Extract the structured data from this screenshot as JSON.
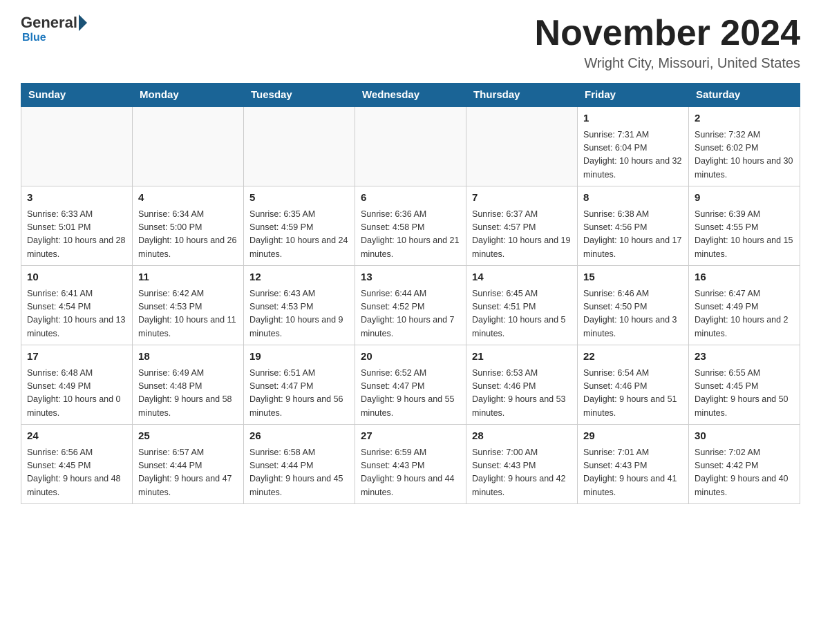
{
  "header": {
    "logo_general": "General",
    "logo_blue": "Blue",
    "month_title": "November 2024",
    "location": "Wright City, Missouri, United States"
  },
  "weekdays": [
    "Sunday",
    "Monday",
    "Tuesday",
    "Wednesday",
    "Thursday",
    "Friday",
    "Saturday"
  ],
  "weeks": [
    [
      {
        "day": "",
        "info": ""
      },
      {
        "day": "",
        "info": ""
      },
      {
        "day": "",
        "info": ""
      },
      {
        "day": "",
        "info": ""
      },
      {
        "day": "",
        "info": ""
      },
      {
        "day": "1",
        "info": "Sunrise: 7:31 AM\nSunset: 6:04 PM\nDaylight: 10 hours and 32 minutes."
      },
      {
        "day": "2",
        "info": "Sunrise: 7:32 AM\nSunset: 6:02 PM\nDaylight: 10 hours and 30 minutes."
      }
    ],
    [
      {
        "day": "3",
        "info": "Sunrise: 6:33 AM\nSunset: 5:01 PM\nDaylight: 10 hours and 28 minutes."
      },
      {
        "day": "4",
        "info": "Sunrise: 6:34 AM\nSunset: 5:00 PM\nDaylight: 10 hours and 26 minutes."
      },
      {
        "day": "5",
        "info": "Sunrise: 6:35 AM\nSunset: 4:59 PM\nDaylight: 10 hours and 24 minutes."
      },
      {
        "day": "6",
        "info": "Sunrise: 6:36 AM\nSunset: 4:58 PM\nDaylight: 10 hours and 21 minutes."
      },
      {
        "day": "7",
        "info": "Sunrise: 6:37 AM\nSunset: 4:57 PM\nDaylight: 10 hours and 19 minutes."
      },
      {
        "day": "8",
        "info": "Sunrise: 6:38 AM\nSunset: 4:56 PM\nDaylight: 10 hours and 17 minutes."
      },
      {
        "day": "9",
        "info": "Sunrise: 6:39 AM\nSunset: 4:55 PM\nDaylight: 10 hours and 15 minutes."
      }
    ],
    [
      {
        "day": "10",
        "info": "Sunrise: 6:41 AM\nSunset: 4:54 PM\nDaylight: 10 hours and 13 minutes."
      },
      {
        "day": "11",
        "info": "Sunrise: 6:42 AM\nSunset: 4:53 PM\nDaylight: 10 hours and 11 minutes."
      },
      {
        "day": "12",
        "info": "Sunrise: 6:43 AM\nSunset: 4:53 PM\nDaylight: 10 hours and 9 minutes."
      },
      {
        "day": "13",
        "info": "Sunrise: 6:44 AM\nSunset: 4:52 PM\nDaylight: 10 hours and 7 minutes."
      },
      {
        "day": "14",
        "info": "Sunrise: 6:45 AM\nSunset: 4:51 PM\nDaylight: 10 hours and 5 minutes."
      },
      {
        "day": "15",
        "info": "Sunrise: 6:46 AM\nSunset: 4:50 PM\nDaylight: 10 hours and 3 minutes."
      },
      {
        "day": "16",
        "info": "Sunrise: 6:47 AM\nSunset: 4:49 PM\nDaylight: 10 hours and 2 minutes."
      }
    ],
    [
      {
        "day": "17",
        "info": "Sunrise: 6:48 AM\nSunset: 4:49 PM\nDaylight: 10 hours and 0 minutes."
      },
      {
        "day": "18",
        "info": "Sunrise: 6:49 AM\nSunset: 4:48 PM\nDaylight: 9 hours and 58 minutes."
      },
      {
        "day": "19",
        "info": "Sunrise: 6:51 AM\nSunset: 4:47 PM\nDaylight: 9 hours and 56 minutes."
      },
      {
        "day": "20",
        "info": "Sunrise: 6:52 AM\nSunset: 4:47 PM\nDaylight: 9 hours and 55 minutes."
      },
      {
        "day": "21",
        "info": "Sunrise: 6:53 AM\nSunset: 4:46 PM\nDaylight: 9 hours and 53 minutes."
      },
      {
        "day": "22",
        "info": "Sunrise: 6:54 AM\nSunset: 4:46 PM\nDaylight: 9 hours and 51 minutes."
      },
      {
        "day": "23",
        "info": "Sunrise: 6:55 AM\nSunset: 4:45 PM\nDaylight: 9 hours and 50 minutes."
      }
    ],
    [
      {
        "day": "24",
        "info": "Sunrise: 6:56 AM\nSunset: 4:45 PM\nDaylight: 9 hours and 48 minutes."
      },
      {
        "day": "25",
        "info": "Sunrise: 6:57 AM\nSunset: 4:44 PM\nDaylight: 9 hours and 47 minutes."
      },
      {
        "day": "26",
        "info": "Sunrise: 6:58 AM\nSunset: 4:44 PM\nDaylight: 9 hours and 45 minutes."
      },
      {
        "day": "27",
        "info": "Sunrise: 6:59 AM\nSunset: 4:43 PM\nDaylight: 9 hours and 44 minutes."
      },
      {
        "day": "28",
        "info": "Sunrise: 7:00 AM\nSunset: 4:43 PM\nDaylight: 9 hours and 42 minutes."
      },
      {
        "day": "29",
        "info": "Sunrise: 7:01 AM\nSunset: 4:43 PM\nDaylight: 9 hours and 41 minutes."
      },
      {
        "day": "30",
        "info": "Sunrise: 7:02 AM\nSunset: 4:42 PM\nDaylight: 9 hours and 40 minutes."
      }
    ]
  ]
}
